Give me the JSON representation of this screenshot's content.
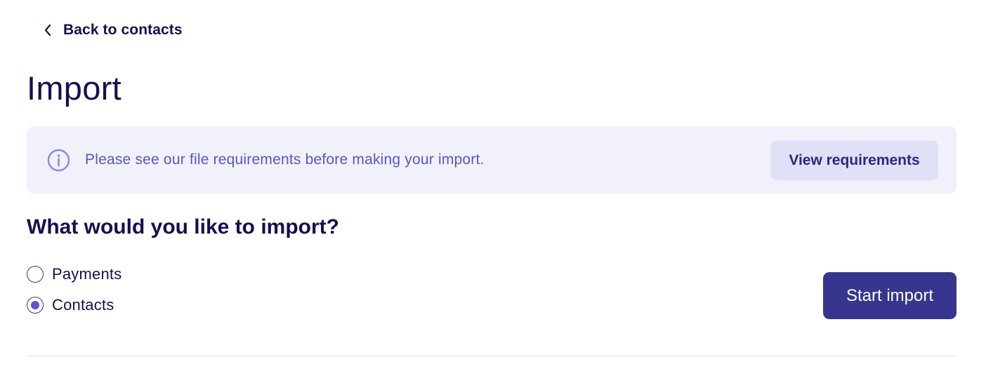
{
  "nav": {
    "back_label": "Back to contacts",
    "back_icon": "chevron-left-icon"
  },
  "page": {
    "title": "Import"
  },
  "banner": {
    "icon": "info-icon",
    "text": "Please see our file requirements before making your import.",
    "button_label": "View requirements"
  },
  "form": {
    "question": "What would you like to import?",
    "options": [
      {
        "label": "Payments",
        "selected": false
      },
      {
        "label": "Contacts",
        "selected": true
      }
    ],
    "submit_label": "Start import"
  },
  "colors": {
    "primary": "#38358f",
    "text": "#14114f",
    "banner_bg": "#f1f1fb",
    "banner_text": "#5a55c9",
    "secondary_button_bg": "#e0e0f7",
    "radio_selected": "#5a55d6"
  }
}
